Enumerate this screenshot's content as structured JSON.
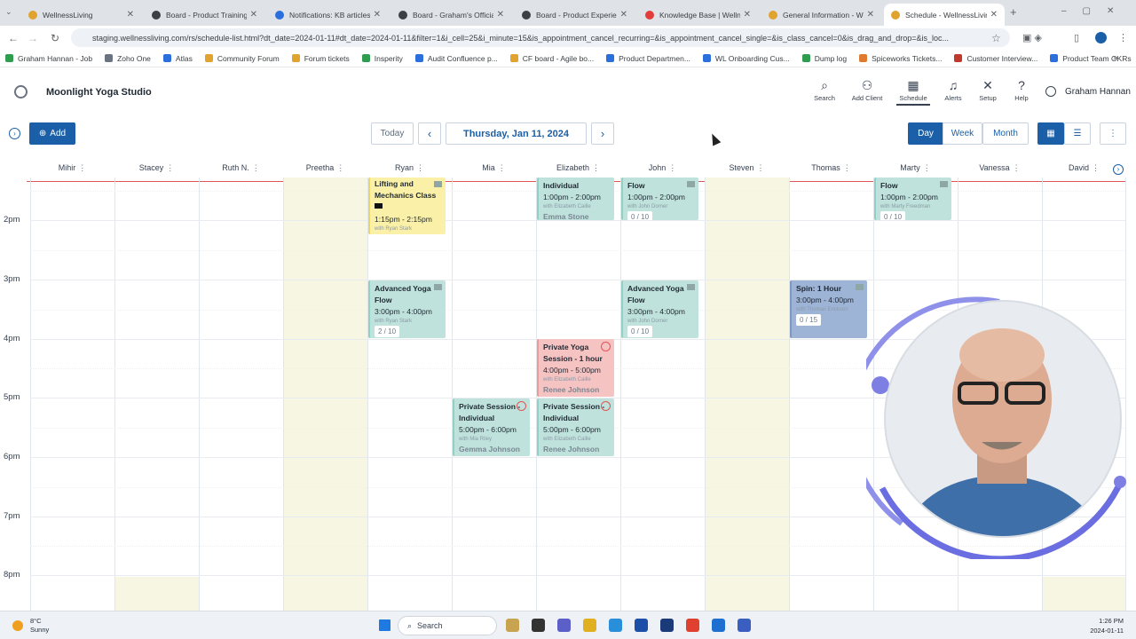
{
  "browser": {
    "tabs": [
      {
        "title": "WellnessLiving",
        "color": "#e0a32e"
      },
      {
        "title": "Board - Product Training",
        "color": "#3c4043"
      },
      {
        "title": "Notifications: KB articles",
        "color": "#2a6fdb"
      },
      {
        "title": "Board - Graham's Official",
        "color": "#3c4043"
      },
      {
        "title": "Board - Product Experien",
        "color": "#3c4043"
      },
      {
        "title": "Knowledge Base | Wellne",
        "color": "#e23c3c"
      },
      {
        "title": "General Information - We",
        "color": "#e0a32e"
      },
      {
        "title": "Schedule - WellnessLiving",
        "color": "#e0a32e"
      }
    ],
    "url": "staging.wellnessliving.com/rs/schedule-list.html?dt_date=2024-01-11#dt_date=2024-01-11&filter=1&i_cell=25&i_minute=15&is_appointment_cancel_recurring=&is_appointment_cancel_single=&is_class_cancel=0&is_drag_and_drop=&is_loc...",
    "bookmarks": [
      {
        "label": "Graham Hannan - Job",
        "color": "#2e9d4e"
      },
      {
        "label": "Zoho One",
        "color": "#6b7280"
      },
      {
        "label": "Atlas",
        "color": "#2a6fdb"
      },
      {
        "label": "Community Forum",
        "color": "#e0a32e"
      },
      {
        "label": "Forum tickets",
        "color": "#e0a32e"
      },
      {
        "label": "Insperity",
        "color": "#2e9d4e"
      },
      {
        "label": "Audit Confluence p...",
        "color": "#2a6fdb"
      },
      {
        "label": "CF board - Agile bo...",
        "color": "#e0a32e"
      },
      {
        "label": "Product Departmen...",
        "color": "#2a6fdb"
      },
      {
        "label": "WL Onboarding Cus...",
        "color": "#2a6fdb"
      },
      {
        "label": "Dump log",
        "color": "#2e9d4e"
      },
      {
        "label": "Spiceworks Tickets...",
        "color": "#e07a2e"
      },
      {
        "label": "Customer Interview...",
        "color": "#c0392b"
      },
      {
        "label": "Product Team OKRs",
        "color": "#2a6fdb"
      }
    ]
  },
  "app": {
    "studio": "Moonlight Yoga Studio",
    "nav": [
      {
        "label": "Search",
        "icon": "search-icon",
        "glyph": "⌕"
      },
      {
        "label": "Add Client",
        "icon": "add-client-icon",
        "glyph": "⚇"
      },
      {
        "label": "Schedule",
        "icon": "calendar-icon",
        "glyph": "▦"
      },
      {
        "label": "Alerts",
        "icon": "bell-icon",
        "glyph": "♫"
      },
      {
        "label": "Setup",
        "icon": "tools-icon",
        "glyph": "✕"
      },
      {
        "label": "Help",
        "icon": "help-icon",
        "glyph": "?"
      }
    ],
    "user": "Graham Hannan"
  },
  "toolbar": {
    "add": "Add",
    "today": "Today",
    "date": "Thursday, Jan 11, 2024",
    "views": [
      "Day",
      "Week",
      "Month"
    ],
    "active_view": "Day"
  },
  "staff": [
    "Mihir",
    "Stacey",
    "Ruth N.",
    "Preetha",
    "Ryan",
    "Mia",
    "Elizabeth",
    "John",
    "Steven",
    "Thomas",
    "Marty",
    "Vanessa",
    "David"
  ],
  "times": [
    "2pm",
    "3pm",
    "4pm",
    "5pm",
    "6pm",
    "7pm",
    "8pm"
  ],
  "events": [
    {
      "color": "yel",
      "col": 4,
      "title": "Lifting and Mechanics Class",
      "time": "1:15pm - 2:15pm",
      "with": "with Ryan Stark",
      "video": true
    },
    {
      "color": "teal",
      "col": 6,
      "title": "Individual",
      "time": "1:00pm - 2:00pm",
      "with": "with Elizabeth Caille",
      "client": "Emma Stone"
    },
    {
      "color": "teal",
      "col": 7,
      "title": "Flow",
      "time": "1:00pm - 2:00pm",
      "with": "with John Dorner",
      "count": "0 / 10"
    },
    {
      "color": "teal",
      "col": 10,
      "title": "Flow",
      "time": "1:00pm - 2:00pm",
      "with": "with Marty Freedman",
      "count": "0 / 10"
    },
    {
      "color": "teal",
      "col": 4,
      "title": "Advanced Yoga Flow",
      "time": "3:00pm - 4:00pm",
      "with": "with Ryan Stark",
      "count": "2 / 10"
    },
    {
      "color": "teal",
      "col": 7,
      "title": "Advanced Yoga Flow",
      "time": "3:00pm - 4:00pm",
      "with": "with John Dorner",
      "count": "0 / 10"
    },
    {
      "color": "blue",
      "col": 9,
      "title": "Spin: 1 Hour",
      "time": "3:00pm - 4:00pm",
      "with": "with Thomas Erickson",
      "count": "0 / 15"
    },
    {
      "color": "pink",
      "col": 6,
      "title": "Private Yoga Session - 1 hour",
      "time": "4:00pm - 5:00pm",
      "with": "with Elizabeth Caille",
      "client": "Renee Johnson"
    },
    {
      "color": "teal",
      "col": 5,
      "title": "Private Session - Individual",
      "time": "5:00pm - 6:00pm",
      "with": "with Mia Riley",
      "client": "Gemma Johnson"
    },
    {
      "color": "teal",
      "col": 6,
      "title": "Private Session - Individual",
      "time": "5:00pm - 6:00pm",
      "with": "with Elizabeth Caille",
      "client": "Renee Johnson"
    }
  ],
  "taskbar": {
    "weather_temp": "8°C",
    "weather_desc": "Sunny",
    "search": "Search",
    "time": "1:26 PM",
    "date": "2024-01-11"
  }
}
